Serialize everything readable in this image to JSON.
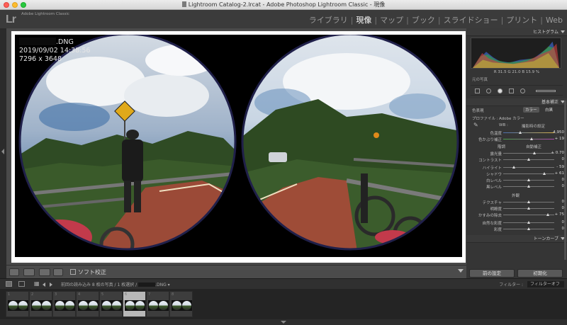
{
  "window": {
    "title": "Lightroom Catalog-2.lrcat - Adobe Photoshop Lightroom Classic - 現像"
  },
  "header": {
    "logo": "Lr",
    "app_name": "Adobe Lightroom Classic",
    "modules": [
      {
        "label": "ライブラリ",
        "active": false
      },
      {
        "label": "現像",
        "active": true
      },
      {
        "label": "マップ",
        "active": false
      },
      {
        "label": "ブック",
        "active": false
      },
      {
        "label": "スライドショー",
        "active": false
      },
      {
        "label": "プリント",
        "active": false
      },
      {
        "label": "Web",
        "active": false
      }
    ]
  },
  "photo_info": {
    "filename_suffix": ".DNG",
    "datetime": "2019/09/02 14:38:56",
    "dimensions": "7296 x 3648"
  },
  "toolbar": {
    "soft_proof_label": "ソフト校正"
  },
  "right_panel": {
    "histogram_title": "ヒストグラム",
    "histogram_values": "R 31.5 G 21.0 B 15.9 %",
    "original_photo": "元の写真",
    "basic_title": "基本補正",
    "treatment_label": "色表現",
    "treatment_color": "カラー",
    "treatment_bw": "白黒",
    "profile_label": "プロファイル :",
    "profile_value": "Adobe カラー",
    "wb_label": "WB :",
    "wb_value": "撮影時の設定",
    "temp_label": "色温度",
    "temp_value": "4,950",
    "tint_label": "色かぶり補正",
    "tint_value": "+ 19",
    "tone_label": "階調",
    "auto_label": "自動補正",
    "exposure_label": "露光量",
    "exposure_value": "+ 0.70",
    "contrast_label": "コントラスト",
    "contrast_value": "0",
    "highlights_label": "ハイライト",
    "highlights_value": "- 59",
    "shadows_label": "シャドウ",
    "shadows_value": "+ 61",
    "whites_label": "白レベル",
    "whites_value": "0",
    "blacks_label": "黒レベル",
    "blacks_value": "0",
    "presence_label": "外観",
    "texture_label": "テクスチャ",
    "texture_value": "0",
    "clarity_label": "明瞭度",
    "clarity_value": "0",
    "dehaze_label": "かすみの除去",
    "dehaze_value": "+ 75",
    "vibrance_label": "自然な彩度",
    "vibrance_value": "0",
    "saturation_label": "彩度",
    "saturation_value": "0",
    "tone_curve_title": "トーンカーブ",
    "previous_button": "前の設定",
    "reset_button": "初期化"
  },
  "filmstrip": {
    "source_text": "前回の読み込み 8 枚の写真 / 1 枚選択 /",
    "source_suffix": ".DNG ▾",
    "filter_label": "フィルター :",
    "filter_value": "フィルターオフ",
    "thumbs": [
      "1",
      "2",
      "3",
      "4",
      "5",
      "6",
      "7",
      "8"
    ],
    "selected_index": 5
  }
}
